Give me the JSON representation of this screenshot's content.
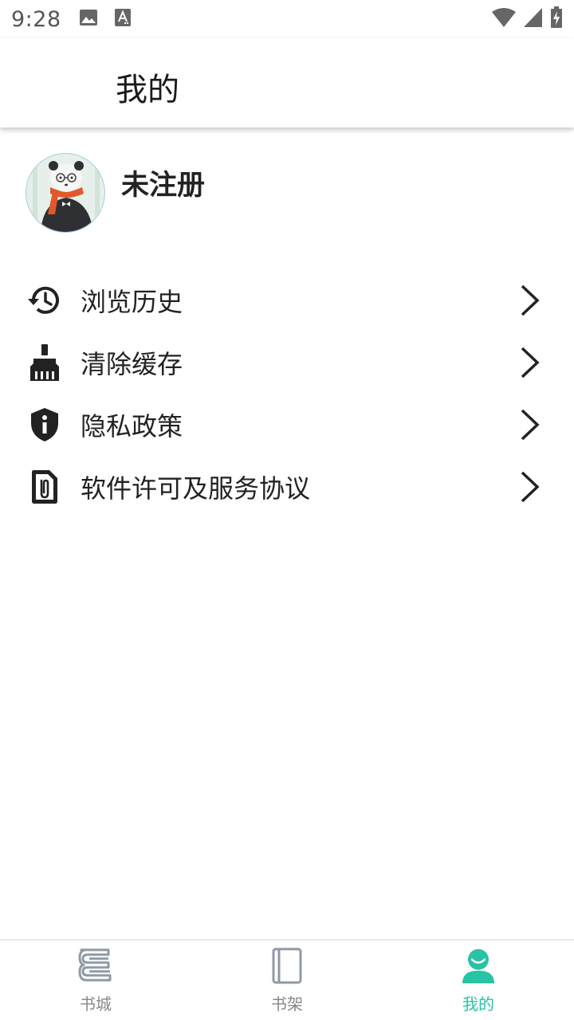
{
  "status_bar": {
    "time": "9:28",
    "icons": [
      "image-notification-icon",
      "keyboard-a-notification-icon",
      "wifi-icon",
      "signal-icon",
      "battery-charging-icon"
    ]
  },
  "app_bar": {
    "title": "我的"
  },
  "profile": {
    "name": "未注册",
    "avatar": "panda-avatar"
  },
  "menu": {
    "items": [
      {
        "label": "浏览历史",
        "icon": "history-icon"
      },
      {
        "label": "清除缓存",
        "icon": "broom-icon"
      },
      {
        "label": "隐私政策",
        "icon": "shield-info-icon"
      },
      {
        "label": "软件许可及服务协议",
        "icon": "attachment-file-icon"
      }
    ]
  },
  "bottom_nav": {
    "items": [
      {
        "label": "书城",
        "icon": "book-store-icon",
        "active": false
      },
      {
        "label": "书架",
        "icon": "bookshelf-icon",
        "active": false
      },
      {
        "label": "我的",
        "icon": "profile-icon",
        "active": true
      }
    ]
  },
  "colors": {
    "accent": "#28c2a5",
    "inactive": "#888888",
    "text": "#222222"
  }
}
